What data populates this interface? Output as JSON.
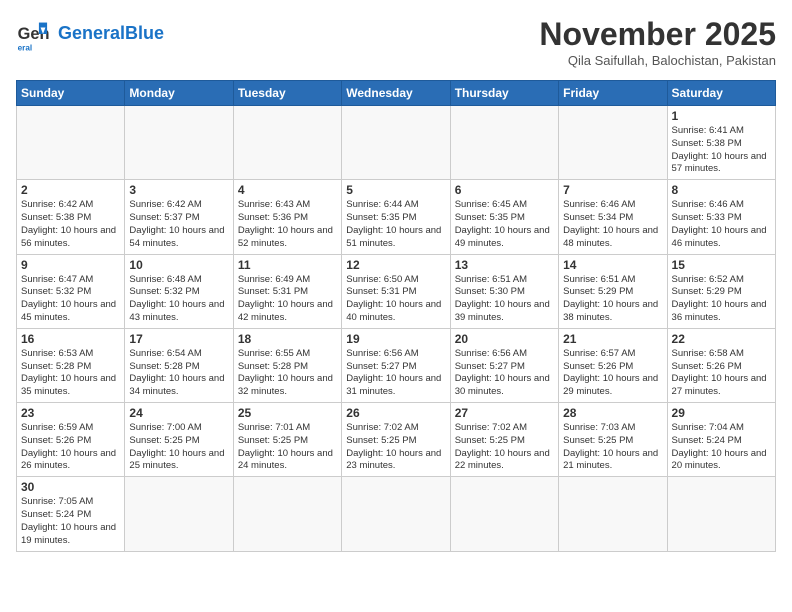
{
  "header": {
    "logo_general": "General",
    "logo_blue": "Blue",
    "month_title": "November 2025",
    "location": "Qila Saifullah, Balochistan, Pakistan"
  },
  "weekdays": [
    "Sunday",
    "Monday",
    "Tuesday",
    "Wednesday",
    "Thursday",
    "Friday",
    "Saturday"
  ],
  "weeks": [
    [
      {
        "day": "",
        "info": ""
      },
      {
        "day": "",
        "info": ""
      },
      {
        "day": "",
        "info": ""
      },
      {
        "day": "",
        "info": ""
      },
      {
        "day": "",
        "info": ""
      },
      {
        "day": "",
        "info": ""
      },
      {
        "day": "1",
        "info": "Sunrise: 6:41 AM\nSunset: 5:38 PM\nDaylight: 10 hours and 57 minutes."
      }
    ],
    [
      {
        "day": "2",
        "info": "Sunrise: 6:42 AM\nSunset: 5:38 PM\nDaylight: 10 hours and 56 minutes."
      },
      {
        "day": "3",
        "info": "Sunrise: 6:42 AM\nSunset: 5:37 PM\nDaylight: 10 hours and 54 minutes."
      },
      {
        "day": "4",
        "info": "Sunrise: 6:43 AM\nSunset: 5:36 PM\nDaylight: 10 hours and 52 minutes."
      },
      {
        "day": "5",
        "info": "Sunrise: 6:44 AM\nSunset: 5:35 PM\nDaylight: 10 hours and 51 minutes."
      },
      {
        "day": "6",
        "info": "Sunrise: 6:45 AM\nSunset: 5:35 PM\nDaylight: 10 hours and 49 minutes."
      },
      {
        "day": "7",
        "info": "Sunrise: 6:46 AM\nSunset: 5:34 PM\nDaylight: 10 hours and 48 minutes."
      },
      {
        "day": "8",
        "info": "Sunrise: 6:46 AM\nSunset: 5:33 PM\nDaylight: 10 hours and 46 minutes."
      }
    ],
    [
      {
        "day": "9",
        "info": "Sunrise: 6:47 AM\nSunset: 5:32 PM\nDaylight: 10 hours and 45 minutes."
      },
      {
        "day": "10",
        "info": "Sunrise: 6:48 AM\nSunset: 5:32 PM\nDaylight: 10 hours and 43 minutes."
      },
      {
        "day": "11",
        "info": "Sunrise: 6:49 AM\nSunset: 5:31 PM\nDaylight: 10 hours and 42 minutes."
      },
      {
        "day": "12",
        "info": "Sunrise: 6:50 AM\nSunset: 5:31 PM\nDaylight: 10 hours and 40 minutes."
      },
      {
        "day": "13",
        "info": "Sunrise: 6:51 AM\nSunset: 5:30 PM\nDaylight: 10 hours and 39 minutes."
      },
      {
        "day": "14",
        "info": "Sunrise: 6:51 AM\nSunset: 5:29 PM\nDaylight: 10 hours and 38 minutes."
      },
      {
        "day": "15",
        "info": "Sunrise: 6:52 AM\nSunset: 5:29 PM\nDaylight: 10 hours and 36 minutes."
      }
    ],
    [
      {
        "day": "16",
        "info": "Sunrise: 6:53 AM\nSunset: 5:28 PM\nDaylight: 10 hours and 35 minutes."
      },
      {
        "day": "17",
        "info": "Sunrise: 6:54 AM\nSunset: 5:28 PM\nDaylight: 10 hours and 34 minutes."
      },
      {
        "day": "18",
        "info": "Sunrise: 6:55 AM\nSunset: 5:28 PM\nDaylight: 10 hours and 32 minutes."
      },
      {
        "day": "19",
        "info": "Sunrise: 6:56 AM\nSunset: 5:27 PM\nDaylight: 10 hours and 31 minutes."
      },
      {
        "day": "20",
        "info": "Sunrise: 6:56 AM\nSunset: 5:27 PM\nDaylight: 10 hours and 30 minutes."
      },
      {
        "day": "21",
        "info": "Sunrise: 6:57 AM\nSunset: 5:26 PM\nDaylight: 10 hours and 29 minutes."
      },
      {
        "day": "22",
        "info": "Sunrise: 6:58 AM\nSunset: 5:26 PM\nDaylight: 10 hours and 27 minutes."
      }
    ],
    [
      {
        "day": "23",
        "info": "Sunrise: 6:59 AM\nSunset: 5:26 PM\nDaylight: 10 hours and 26 minutes."
      },
      {
        "day": "24",
        "info": "Sunrise: 7:00 AM\nSunset: 5:25 PM\nDaylight: 10 hours and 25 minutes."
      },
      {
        "day": "25",
        "info": "Sunrise: 7:01 AM\nSunset: 5:25 PM\nDaylight: 10 hours and 24 minutes."
      },
      {
        "day": "26",
        "info": "Sunrise: 7:02 AM\nSunset: 5:25 PM\nDaylight: 10 hours and 23 minutes."
      },
      {
        "day": "27",
        "info": "Sunrise: 7:02 AM\nSunset: 5:25 PM\nDaylight: 10 hours and 22 minutes."
      },
      {
        "day": "28",
        "info": "Sunrise: 7:03 AM\nSunset: 5:25 PM\nDaylight: 10 hours and 21 minutes."
      },
      {
        "day": "29",
        "info": "Sunrise: 7:04 AM\nSunset: 5:24 PM\nDaylight: 10 hours and 20 minutes."
      }
    ],
    [
      {
        "day": "30",
        "info": "Sunrise: 7:05 AM\nSunset: 5:24 PM\nDaylight: 10 hours and 19 minutes."
      },
      {
        "day": "",
        "info": ""
      },
      {
        "day": "",
        "info": ""
      },
      {
        "day": "",
        "info": ""
      },
      {
        "day": "",
        "info": ""
      },
      {
        "day": "",
        "info": ""
      },
      {
        "day": "",
        "info": ""
      }
    ]
  ]
}
